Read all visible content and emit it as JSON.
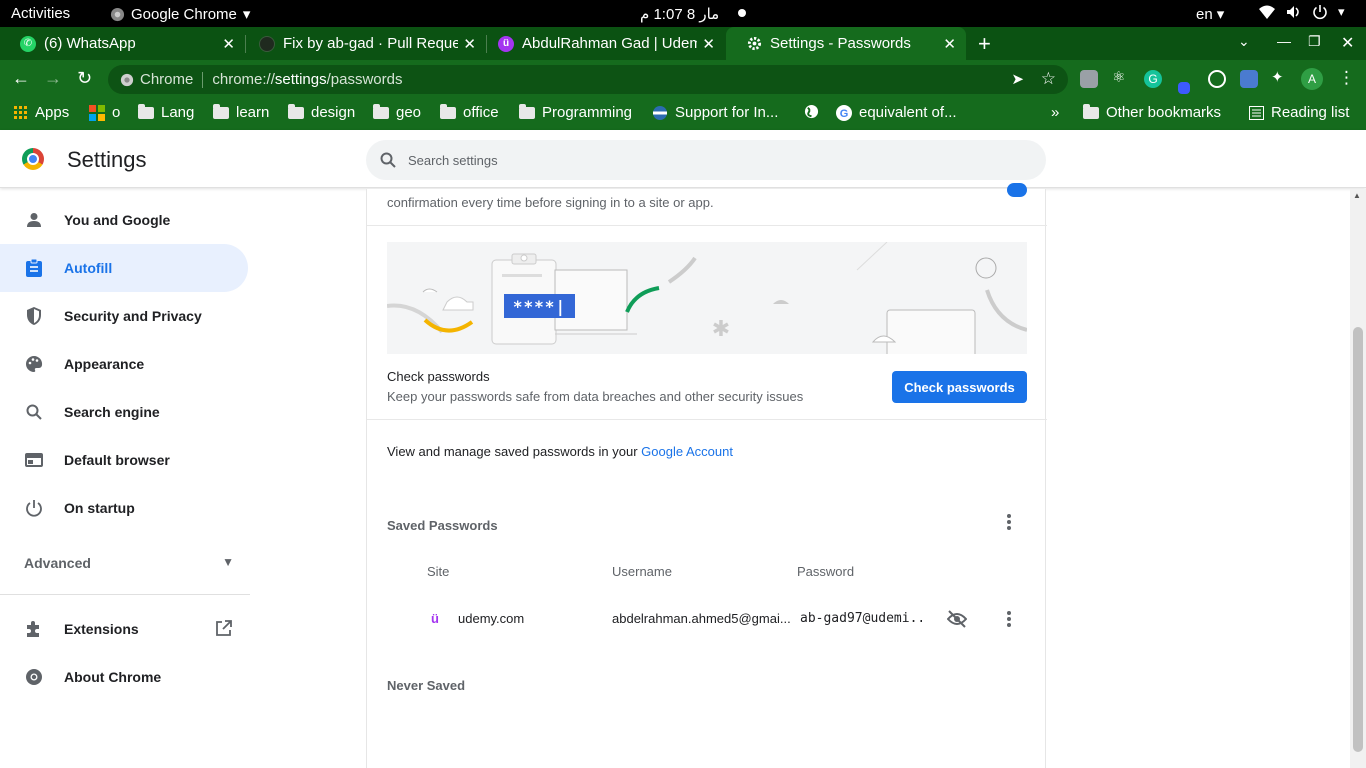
{
  "topbar": {
    "activities": "Activities",
    "app_name": "Google Chrome",
    "clock": "مار 8  1:07 م",
    "lang": "en"
  },
  "tabs": [
    {
      "title": "(6) WhatsApp",
      "favicon": "whatsapp-icon",
      "color": "#25d366"
    },
    {
      "title": "Fix by ab-gad · Pull Reque",
      "favicon": "github-icon",
      "color": "#24292e"
    },
    {
      "title": "AbdulRahman Gad | Udem",
      "favicon": "udemy-icon",
      "color": "#a435f0"
    },
    {
      "title": "Settings - Passwords",
      "favicon": "gear-icon",
      "color": "#ffffff",
      "active": true
    }
  ],
  "omnibox": {
    "chip": "Chrome",
    "url_prefix": "chrome://",
    "url_host": "settings",
    "url_path": "/passwords"
  },
  "bookmarks": {
    "items": [
      "Apps",
      "o",
      "Lang",
      "learn",
      "design",
      "geo",
      "office",
      "Programming",
      "Support for In...",
      "",
      "equivalent of..."
    ],
    "overflow": "»",
    "other": "Other bookmarks",
    "reading_list": "Reading list"
  },
  "header": {
    "title": "Settings",
    "search_placeholder": "Search settings"
  },
  "sidebar": {
    "items": [
      {
        "label": "You and Google",
        "icon": "person-icon"
      },
      {
        "label": "Autofill",
        "icon": "clipboard-icon",
        "selected": true
      },
      {
        "label": "Security and Privacy",
        "icon": "shield-icon"
      },
      {
        "label": "Appearance",
        "icon": "palette-icon"
      },
      {
        "label": "Search engine",
        "icon": "search-icon"
      },
      {
        "label": "Default browser",
        "icon": "browser-icon"
      },
      {
        "label": "On startup",
        "icon": "power-icon"
      }
    ],
    "advanced": "Advanced",
    "extensions": "Extensions",
    "about": "About Chrome"
  },
  "main": {
    "top_text": "confirmation every time before signing in to a site or app.",
    "illustration_password": "****|",
    "check_title": "Check passwords",
    "check_desc": "Keep your passwords safe from data breaches and other security issues",
    "check_button": "Check passwords",
    "manage_text": "View and manage saved passwords in your ",
    "manage_link": "Google Account",
    "saved_heading": "Saved Passwords",
    "columns": [
      "Site",
      "Username",
      "Password"
    ],
    "rows": [
      {
        "site": "udemy.com",
        "username": "abdelrahman.ahmed5@gmai...",
        "password": "ab-gad97@udemi..."
      }
    ],
    "never_saved": "Never Saved"
  },
  "colors": {
    "accent": "#1a73e8",
    "frame": "#156b1d",
    "frame_dark": "#0b5212"
  }
}
